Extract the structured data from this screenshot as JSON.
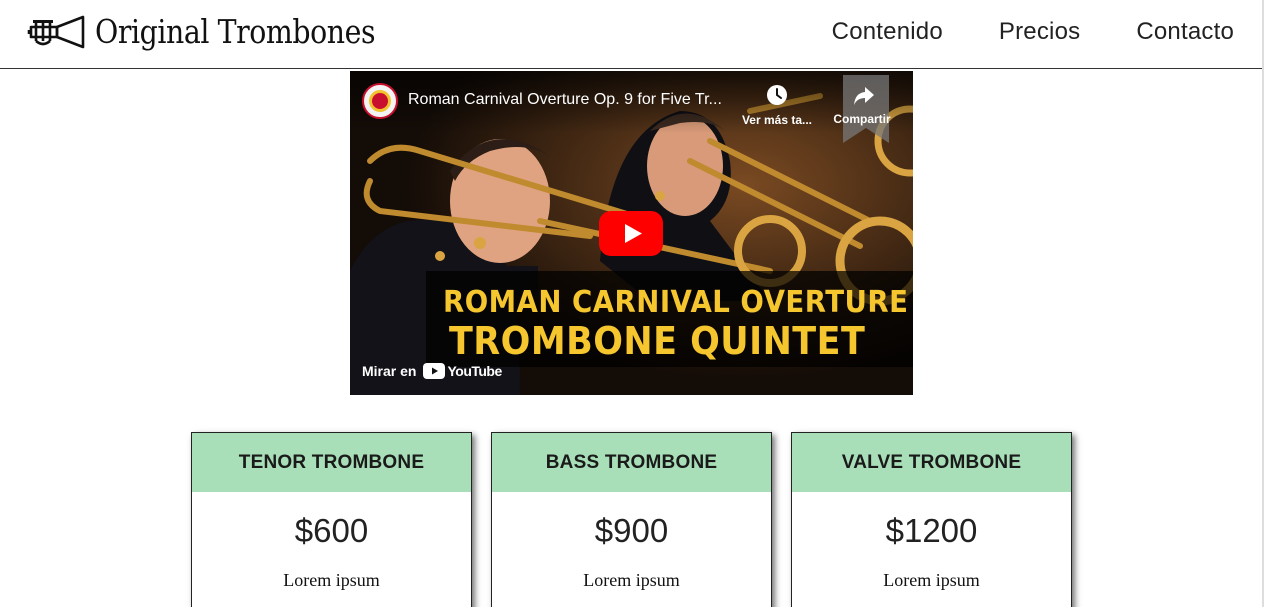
{
  "header": {
    "brand_name": "Original Trombones",
    "nav": [
      "Contenido",
      "Precios",
      "Contacto"
    ]
  },
  "video": {
    "title": "Roman Carnival Overture Op. 9 for Five Tr...",
    "watch_later_label": "Ver más ta...",
    "share_label": "Compartir",
    "overlay_line1": "ROMAN CARNIVAL OVERTURE",
    "overlay_line2": "TROMBONE QUINTET",
    "watch_on_label": "Mirar en",
    "platform_name": "YouTube"
  },
  "pricing": [
    {
      "name": "TENOR TROMBONE",
      "price": "$600",
      "description": "Lorem ipsum"
    },
    {
      "name": "BASS TROMBONE",
      "price": "$900",
      "description": "Lorem ipsum"
    },
    {
      "name": "VALVE TROMBONE",
      "price": "$1200",
      "description": "Lorem ipsum"
    }
  ],
  "colors": {
    "card_header": "#a8dfb8",
    "play_button": "#ff0000",
    "overlay_text": "#f6c62f"
  },
  "icons": {
    "brand": "trumpet-icon",
    "watch_later": "clock-icon",
    "share": "share-icon",
    "play": "play-icon",
    "platform": "youtube-logo"
  }
}
